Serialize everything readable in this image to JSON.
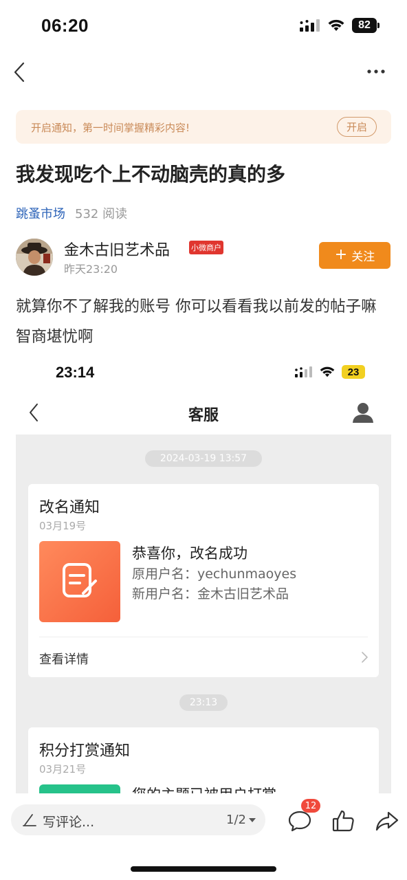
{
  "status_bar": {
    "time": "06:20",
    "battery": "82"
  },
  "notice": {
    "text": "开启通知，第一时间掌握精彩内容!",
    "button": "开启"
  },
  "post": {
    "title": "我发现吃个上不动脑壳的真的多",
    "board": "跳蚤市场",
    "views": "532 阅读",
    "author": {
      "name": "金木古旧艺术品",
      "badge": "小微商户",
      "time": "昨天23:20"
    },
    "follow_label": "关注",
    "body": "就算你不了解我的账号 你可以看看我以前发的帖子嘛 智商堪忧啊"
  },
  "screenshot": {
    "status_time": "23:14",
    "battery": "23",
    "title": "客服",
    "timestamp_1": "2024-03-19 13:57",
    "card1": {
      "title": "改名通知",
      "date": "03月19号",
      "headline": "恭喜你，改名成功",
      "line1": "原用户名：yechunmaoyes",
      "line2": "新用户名：金木古旧艺术品",
      "footer": "查看详情"
    },
    "timestamp_2": "23:13",
    "card2": {
      "title": "积分打赏通知",
      "date": "03月21号",
      "headline": "您的主题已被用户打赏"
    }
  },
  "bottom_bar": {
    "comment_placeholder": "写评论...",
    "page": "1/2",
    "comment_count": "12"
  },
  "icons": {
    "back": "chevron-left-icon",
    "more": "more-dots-icon",
    "user": "user-icon",
    "pen": "pen-icon",
    "comment": "comment-bubble-icon",
    "like": "thumbs-up-icon",
    "share": "share-arrow-icon"
  }
}
